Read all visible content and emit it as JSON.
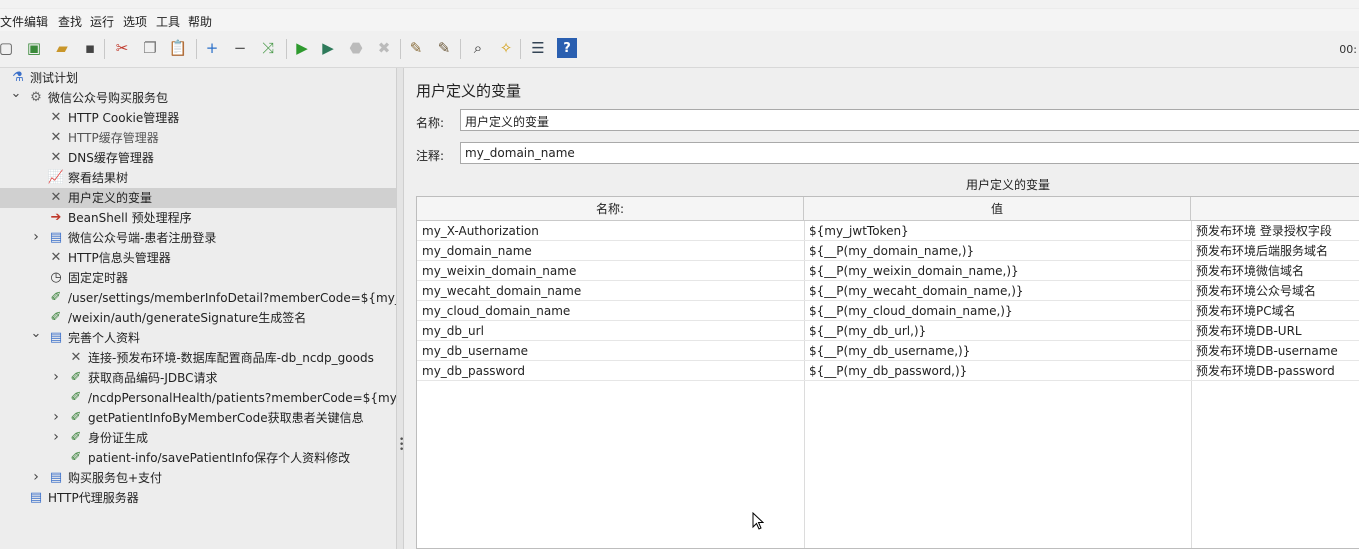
{
  "menu": [
    "文件",
    "编辑",
    "查找",
    "运行",
    "选项",
    "工具",
    "帮助"
  ],
  "toolbar": {
    "buttons": [
      {
        "name": "new-icon",
        "glyph": "▢",
        "color": "#555"
      },
      {
        "name": "templates-icon",
        "glyph": "▣",
        "color": "#3a8a3a"
      },
      {
        "name": "open-icon",
        "glyph": "▰",
        "color": "#c9962a"
      },
      {
        "name": "save-icon",
        "glyph": "▪",
        "color": "#444"
      },
      {
        "name": "cut-icon",
        "glyph": "✂",
        "color": "#c0392b"
      },
      {
        "name": "copy-icon",
        "glyph": "❐",
        "color": "#777"
      },
      {
        "name": "paste-icon",
        "glyph": "📋",
        "color": "#8a6d3b"
      },
      {
        "name": "expand-icon",
        "glyph": "+",
        "color": "#2a6fc9"
      },
      {
        "name": "collapse-icon",
        "glyph": "−",
        "color": "#555"
      },
      {
        "name": "toggle-icon",
        "glyph": "⤨",
        "color": "#4a9a4a"
      },
      {
        "name": "start-icon",
        "glyph": "▶",
        "color": "#2e9a2e"
      },
      {
        "name": "start-no-pause-icon",
        "glyph": "▶",
        "color": "#2e7a5a"
      },
      {
        "name": "stop-icon",
        "glyph": "⬣",
        "color": "#bbbbbb"
      },
      {
        "name": "shutdown-icon",
        "glyph": "✖",
        "color": "#bbbbbb"
      },
      {
        "name": "clear-icon",
        "glyph": "✎",
        "color": "#8a6d3b"
      },
      {
        "name": "clear-all-icon",
        "glyph": "✎",
        "color": "#6d5a3b"
      },
      {
        "name": "search-icon",
        "glyph": "⌕",
        "color": "#333"
      },
      {
        "name": "reset-search-icon",
        "glyph": "✧",
        "color": "#d4a017"
      },
      {
        "name": "function-helper-icon",
        "glyph": "☰",
        "color": "#345"
      },
      {
        "name": "help-icon",
        "glyph": "?",
        "color": "#fff"
      }
    ],
    "timer": "00:"
  },
  "tree": [
    {
      "label": "测试计划",
      "icon": "flask-icon",
      "glyph": "⚗",
      "color": "#3a6fc9",
      "expand": "",
      "level": 0,
      "selected": false,
      "dim": false
    },
    {
      "label": "微信公众号购买服务包",
      "icon": "thread-group-icon",
      "glyph": "⚙",
      "color": "#666",
      "expand": "v",
      "level": 1,
      "selected": false,
      "dim": false
    },
    {
      "label": "HTTP Cookie管理器",
      "icon": "config-icon",
      "glyph": "✕",
      "color": "#555",
      "expand": "",
      "level": 2,
      "selected": false,
      "dim": false
    },
    {
      "label": "HTTP缓存管理器",
      "icon": "config-icon",
      "glyph": "✕",
      "color": "#555",
      "expand": "",
      "level": 2,
      "selected": false,
      "dim": true
    },
    {
      "label": "DNS缓存管理器",
      "icon": "config-icon",
      "glyph": "✕",
      "color": "#555",
      "expand": "",
      "level": 2,
      "selected": false,
      "dim": false
    },
    {
      "label": "察看结果树",
      "icon": "listener-icon",
      "glyph": "📈",
      "color": "#c0392b",
      "expand": "",
      "level": 2,
      "selected": false,
      "dim": false
    },
    {
      "label": "用户定义的变量",
      "icon": "config-icon",
      "glyph": "✕",
      "color": "#555",
      "expand": "",
      "level": 2,
      "selected": true,
      "dim": false
    },
    {
      "label": "BeanShell 预处理程序",
      "icon": "preprocessor-icon",
      "glyph": "➔",
      "color": "#c0392b",
      "expand": "",
      "level": 2,
      "selected": false,
      "dim": false
    },
    {
      "label": "微信公众号端-患者注册登录",
      "icon": "controller-icon",
      "glyph": "▤",
      "color": "#3a6fc9",
      "expand": ">",
      "level": 2,
      "selected": false,
      "dim": false
    },
    {
      "label": "HTTP信息头管理器",
      "icon": "config-icon",
      "glyph": "✕",
      "color": "#555",
      "expand": "",
      "level": 2,
      "selected": false,
      "dim": false
    },
    {
      "label": "固定定时器",
      "icon": "timer-icon",
      "glyph": "◷",
      "color": "#333",
      "expand": "",
      "level": 2,
      "selected": false,
      "dim": false
    },
    {
      "label": "/user/settings/memberInfoDetail?memberCode=${my_memb",
      "icon": "sampler-icon",
      "glyph": "✐",
      "color": "#2e7a2e",
      "expand": "",
      "level": 2,
      "selected": false,
      "dim": false
    },
    {
      "label": "/weixin/auth/generateSignature生成签名",
      "icon": "sampler-icon",
      "glyph": "✐",
      "color": "#2e7a2e",
      "expand": "",
      "level": 2,
      "selected": false,
      "dim": false
    },
    {
      "label": "完善个人资料",
      "icon": "controller-icon",
      "glyph": "▤",
      "color": "#3a6fc9",
      "expand": "v",
      "level": 2,
      "selected": false,
      "dim": false
    },
    {
      "label": "连接-预发布环境-数据库配置商品库-db_ncdp_goods",
      "icon": "config-icon",
      "glyph": "✕",
      "color": "#555",
      "expand": "",
      "level": 3,
      "selected": false,
      "dim": false
    },
    {
      "label": "获取商品编码-JDBC请求",
      "icon": "sampler-icon",
      "glyph": "✐",
      "color": "#2e7a2e",
      "expand": ">",
      "level": 3,
      "selected": false,
      "dim": false
    },
    {
      "label": "/ncdpPersonalHealth/patients?memberCode=${my_mem",
      "icon": "sampler-icon",
      "glyph": "✐",
      "color": "#2e7a2e",
      "expand": "",
      "level": 3,
      "selected": false,
      "dim": false
    },
    {
      "label": "getPatientInfoByMemberCode获取患者关键信息",
      "icon": "sampler-icon",
      "glyph": "✐",
      "color": "#2e7a2e",
      "expand": ">",
      "level": 3,
      "selected": false,
      "dim": false
    },
    {
      "label": "身份证生成",
      "icon": "sampler-icon",
      "glyph": "✐",
      "color": "#2e7a2e",
      "expand": ">",
      "level": 3,
      "selected": false,
      "dim": false
    },
    {
      "label": "patient-info/savePatientInfo保存个人资料修改",
      "icon": "sampler-icon",
      "glyph": "✐",
      "color": "#2e7a2e",
      "expand": "",
      "level": 3,
      "selected": false,
      "dim": false
    },
    {
      "label": "购买服务包+支付",
      "icon": "controller-icon",
      "glyph": "▤",
      "color": "#3a6fc9",
      "expand": ">",
      "level": 2,
      "selected": false,
      "dim": false
    },
    {
      "label": "HTTP代理服务器",
      "icon": "controller-icon",
      "glyph": "▤",
      "color": "#3a6fc9",
      "expand": "",
      "level": 1,
      "selected": false,
      "dim": false
    }
  ],
  "panel": {
    "title": "用户定义的变量",
    "name_label": "名称:",
    "name_value": "用户定义的变量",
    "comment_label": "注释:",
    "comment_value": "my_domain_name",
    "table_caption": "用户定义的变量",
    "columns": [
      "名称:",
      "值",
      ""
    ],
    "rows": [
      {
        "name": "my_X-Authorization",
        "value": "${my_jwtToken}",
        "desc": "预发布环境 登录授权字段"
      },
      {
        "name": "my_domain_name",
        "value": "${__P(my_domain_name,)}",
        "desc": "预发布环境后端服务域名"
      },
      {
        "name": "my_weixin_domain_name",
        "value": "${__P(my_weixin_domain_name,)}",
        "desc": "预发布环境微信域名"
      },
      {
        "name": "my_wecaht_domain_name",
        "value": "${__P(my_wecaht_domain_name,)}",
        "desc": "预发布环境公众号域名"
      },
      {
        "name": "my_cloud_domain_name",
        "value": "${__P(my_cloud_domain_name,)}",
        "desc": "预发布环境PC域名"
      },
      {
        "name": "my_db_url",
        "value": "${__P(my_db_url,)}",
        "desc": "预发布环境DB-URL"
      },
      {
        "name": "my_db_username",
        "value": "${__P(my_db_username,)}",
        "desc": "预发布环境DB-username"
      },
      {
        "name": "my_db_password",
        "value": "${__P(my_db_password,)}",
        "desc": "预发布环境DB-password"
      }
    ]
  }
}
